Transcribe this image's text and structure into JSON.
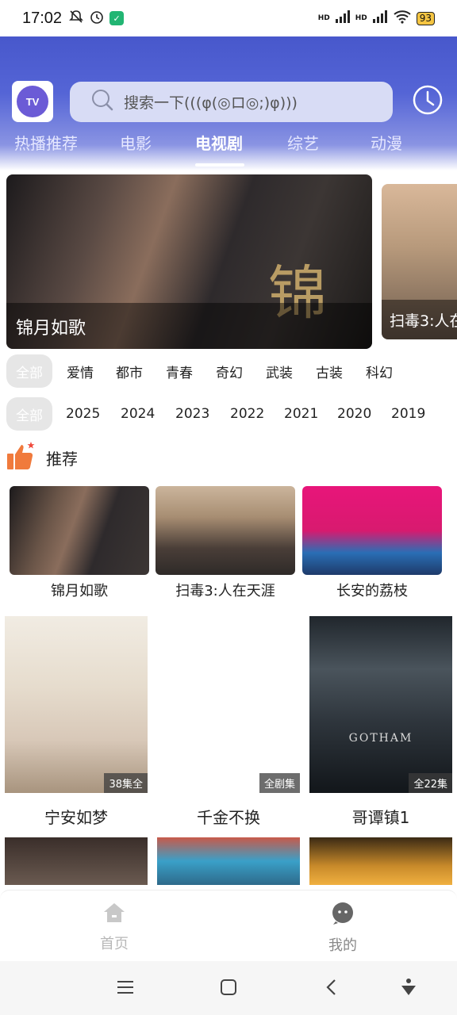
{
  "status_bar": {
    "time": "17:02",
    "battery": "93",
    "net1": "HD",
    "net2": "HD"
  },
  "header": {
    "logo_text": "TV",
    "search_placeholder": "搜索一下(((φ(◎ロ◎;)φ)))",
    "tabs": [
      {
        "label": "热播推荐"
      },
      {
        "label": "电影"
      },
      {
        "label": "电视剧",
        "active": true
      },
      {
        "label": "综艺"
      },
      {
        "label": "动漫"
      }
    ]
  },
  "banners": [
    {
      "title": "锦月如歌",
      "glyph": "锦"
    },
    {
      "title": "扫毒3:人在"
    }
  ],
  "genre_filters": [
    "全部",
    "爱情",
    "都市",
    "青春",
    "奇幻",
    "武装",
    "古装",
    "科幻"
  ],
  "year_filters": [
    "全部",
    "2025",
    "2024",
    "2023",
    "2022",
    "2021",
    "2020",
    "2019"
  ],
  "recommend": {
    "title": "推荐",
    "items": [
      {
        "title": "锦月如歌"
      },
      {
        "title": "扫毒3:人在天涯"
      },
      {
        "title": "长安的荔枝"
      }
    ]
  },
  "posters": [
    {
      "title": "宁安如梦",
      "badge": "38集全"
    },
    {
      "title": "千金不换",
      "badge": "全剧集"
    },
    {
      "title": "哥谭镇1",
      "badge": "全22集",
      "poster_text": "GOTHAM"
    }
  ],
  "bottom_nav": [
    {
      "label": "首页"
    },
    {
      "label": "我的"
    }
  ],
  "colors": {
    "header_blue": "#3f4fc5",
    "search_bg": "#d8dcf5",
    "thumb_orange": "#f07a3c"
  }
}
